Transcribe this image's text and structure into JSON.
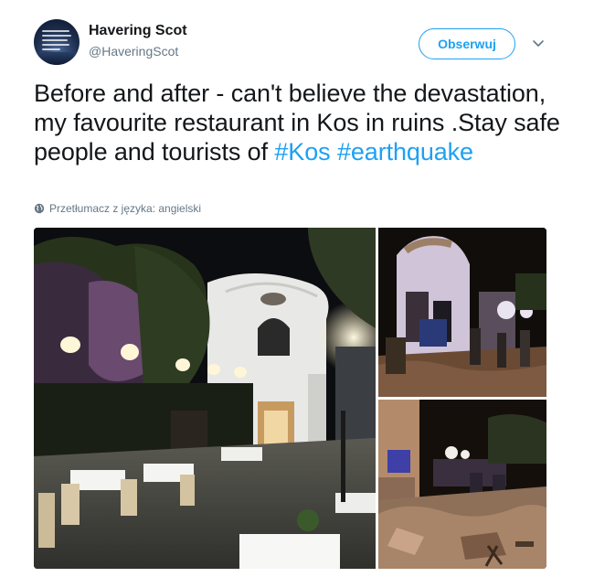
{
  "tweet": {
    "author_name": "Havering Scot",
    "author_handle": "@HaveringScot",
    "follow_label": "Obserwuj",
    "text_plain": "Before and after - can't believe the devastation, my favourite restaurant in Kos in ruins .Stay safe people and tourists of ",
    "hashtags": [
      "#Kos",
      "#earthquake"
    ],
    "translate_label": "Przetłumacz z języka: angielski"
  },
  "icons": {
    "avatar": "profile-avatar",
    "more": "chevron-down-icon",
    "translate": "globe-icon"
  },
  "colors": {
    "accent": "#1da1f2",
    "text": "#14171a",
    "secondary": "#657786"
  }
}
